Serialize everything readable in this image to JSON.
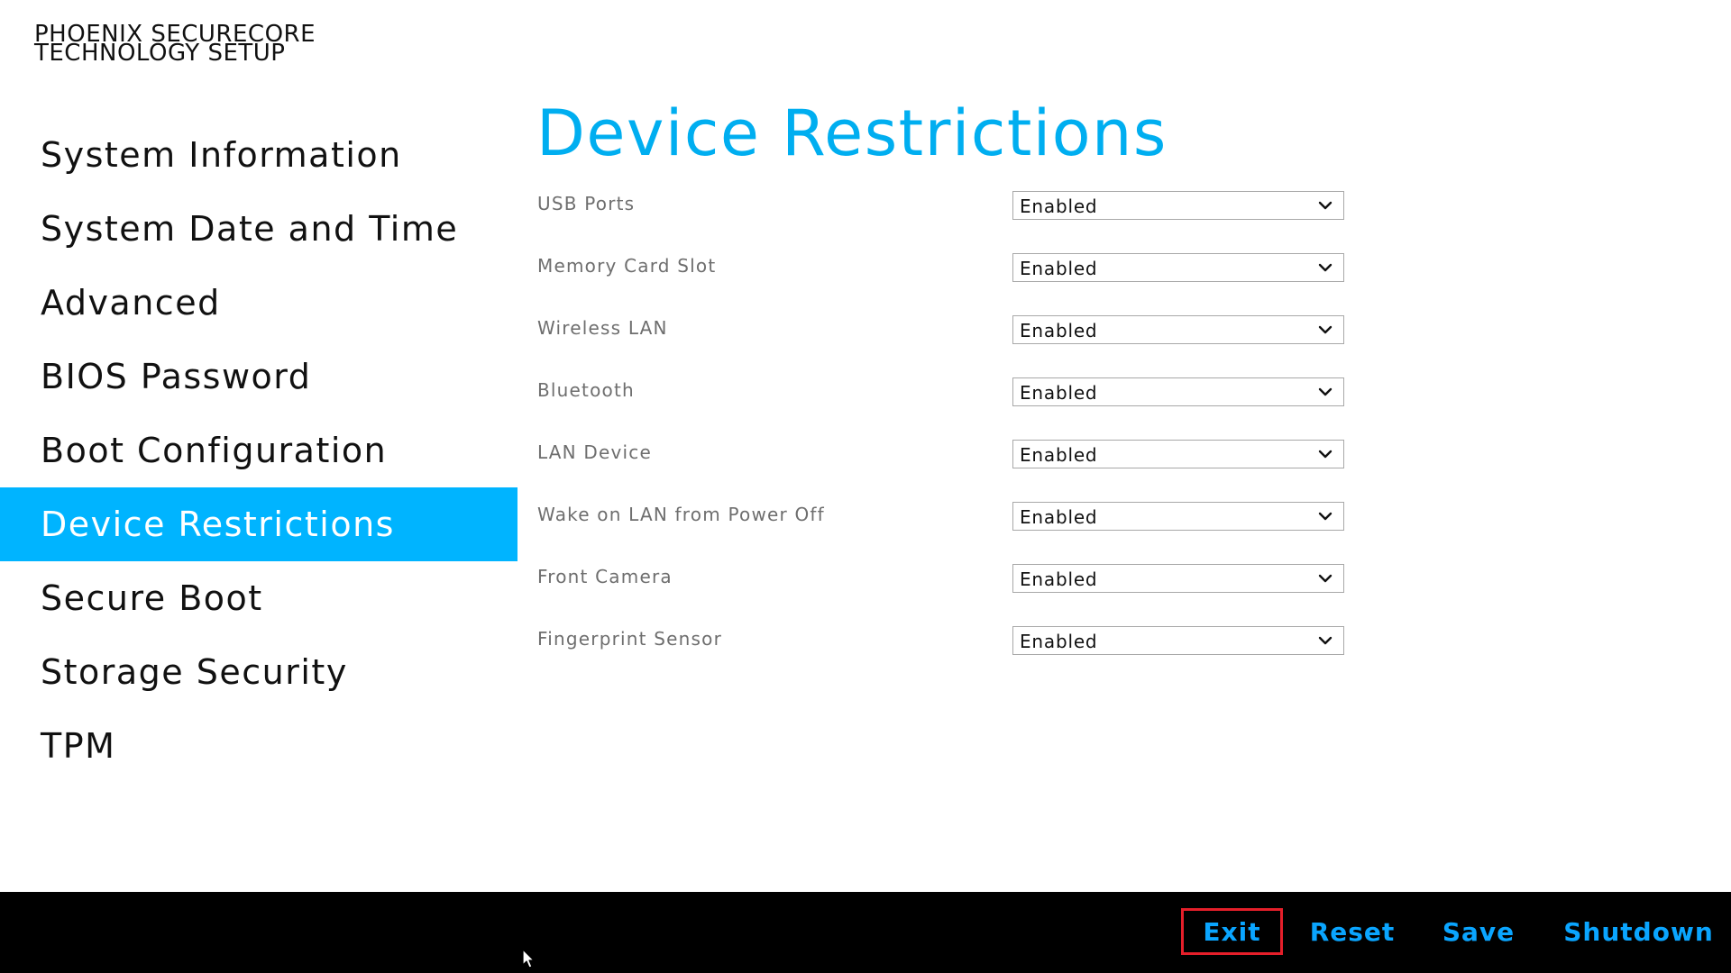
{
  "brand": {
    "line1": "PHOENIX SECURECORE",
    "line2": "TECHNOLOGY SETUP"
  },
  "sidebar": {
    "items": [
      {
        "label": "System Information"
      },
      {
        "label": "System Date and Time"
      },
      {
        "label": "Advanced"
      },
      {
        "label": "BIOS Password"
      },
      {
        "label": "Boot Configuration"
      },
      {
        "label": "Device Restrictions",
        "active": true
      },
      {
        "label": "Secure Boot"
      },
      {
        "label": "Storage Security"
      },
      {
        "label": "TPM"
      }
    ]
  },
  "main": {
    "title": "Device Restrictions",
    "settings": [
      {
        "label": "USB Ports",
        "value": "Enabled"
      },
      {
        "label": "Memory Card Slot",
        "value": "Enabled"
      },
      {
        "label": "Wireless LAN",
        "value": "Enabled"
      },
      {
        "label": "Bluetooth",
        "value": "Enabled"
      },
      {
        "label": "LAN Device",
        "value": "Enabled"
      },
      {
        "label": "Wake on LAN from Power Off",
        "value": "Enabled"
      },
      {
        "label": "Front Camera",
        "value": "Enabled"
      },
      {
        "label": "Fingerprint Sensor",
        "value": "Enabled"
      }
    ]
  },
  "footer": {
    "exit_label": "Exit",
    "reset_label": "Reset",
    "save_label": "Save",
    "shutdown_label": "Shutdown"
  },
  "colors": {
    "accent": "#00b4ff",
    "title": "#00aef0",
    "footer_bg": "#000000",
    "footer_text": "#0aa5ff",
    "focus_border": "#e51f2a"
  },
  "icons": {
    "dropdown": "chevron-down-icon",
    "pointer": "mouse-pointer-icon"
  }
}
